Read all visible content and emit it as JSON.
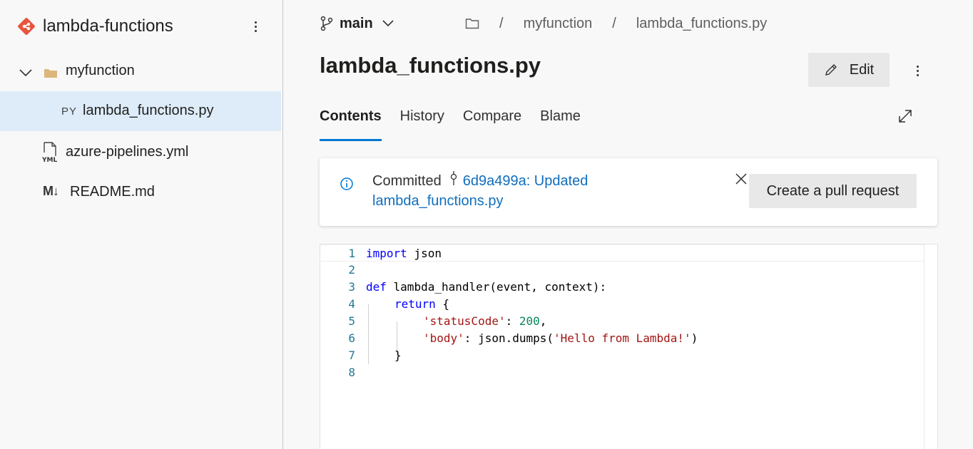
{
  "sidebar": {
    "repo_name": "lambda-functions",
    "tree": [
      {
        "label": "myfunction",
        "type": "folder",
        "expanded": true
      },
      {
        "label": "lambda_functions.py",
        "type": "file",
        "badge": "PY",
        "selected": true
      },
      {
        "label": "azure-pipelines.yml",
        "type": "file",
        "badge": "YML"
      },
      {
        "label": "README.md",
        "type": "file",
        "badge": "M↓"
      }
    ]
  },
  "header": {
    "branch": "main",
    "breadcrumb": [
      "myfunction",
      "lambda_functions.py"
    ],
    "title": "lambda_functions.py",
    "edit_label": "Edit"
  },
  "tabs": [
    {
      "label": "Contents",
      "active": true
    },
    {
      "label": "History"
    },
    {
      "label": "Compare"
    },
    {
      "label": "Blame"
    }
  ],
  "notice": {
    "prefix": "Committed",
    "commit_link": "6d9a499a: Updated lambda_functions.py",
    "pr_button": "Create a pull request"
  },
  "code": {
    "line_numbers": [
      "1",
      "2",
      "3",
      "4",
      "5",
      "6",
      "7",
      "8"
    ],
    "tokens": {
      "l1_kw": "import",
      "l1_rest": " json",
      "l3_kw": "def",
      "l3_rest": " lambda_handler(event, context):",
      "l4_kw": "return",
      "l4_rest": " {",
      "l5_str": "'statusCode'",
      "l5_mid": ": ",
      "l5_num": "200",
      "l5_end": ",",
      "l6_str1": "'body'",
      "l6_mid": ": json.dumps(",
      "l6_str2": "'Hello from Lambda!'",
      "l6_end": ")",
      "l7": "}"
    }
  },
  "colors": {
    "accent": "#0078d4",
    "link": "#106ebe",
    "selected_row": "#deecf9",
    "keyword": "#0000ff",
    "string": "#a31515",
    "number": "#098658",
    "line_number": "#237893",
    "repo_icon": "#e8543c"
  },
  "icons": {
    "repo": "git-repo-icon",
    "branch": "branch-icon",
    "info": "info-icon",
    "close": "close-icon",
    "expand": "expand-icon",
    "edit": "pencil-icon"
  }
}
